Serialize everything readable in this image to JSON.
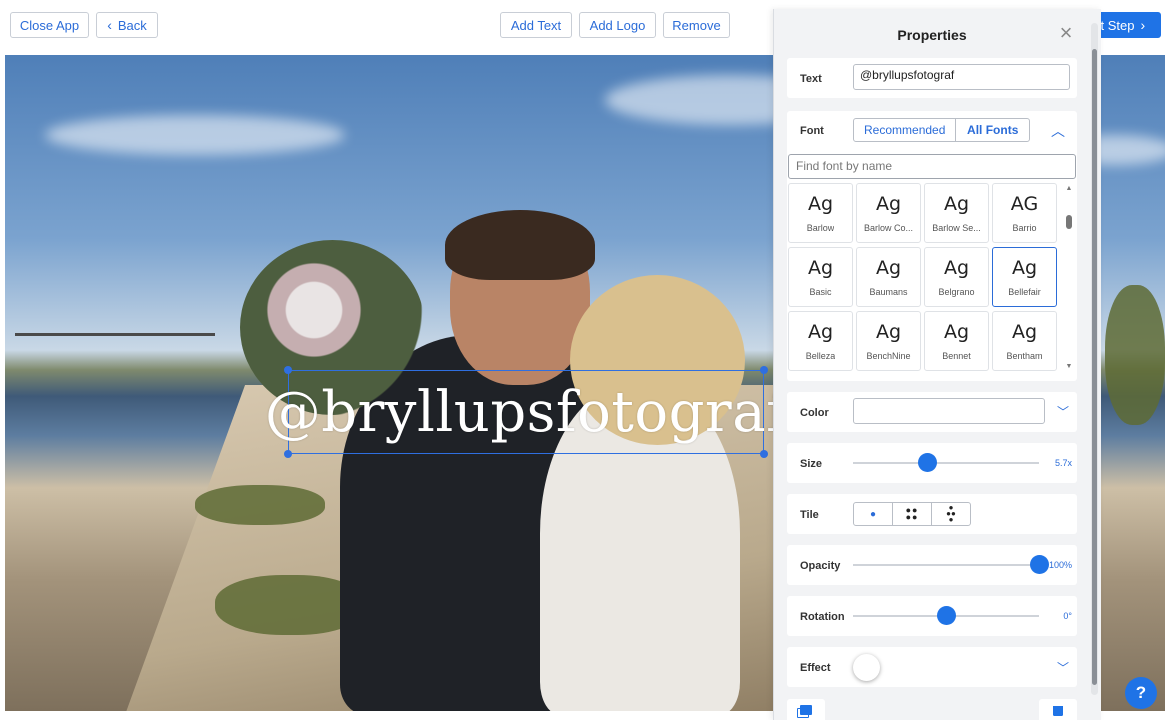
{
  "toolbar": {
    "close_app": "Close App",
    "back": "Back",
    "add_text": "Add Text",
    "add_logo": "Add Logo",
    "remove": "Remove",
    "next_step": "xt Step"
  },
  "canvas": {
    "overlay_text": "@bryllupsfotograf"
  },
  "panel": {
    "title": "Properties",
    "text_label": "Text",
    "text_value": "@bryllupsfotograf",
    "font_label": "Font",
    "font_tabs": [
      "Recommended",
      "All Fonts"
    ],
    "font_search_placeholder": "Find font by name",
    "fonts": [
      {
        "name": "Barlow",
        "sample": "Ag"
      },
      {
        "name": "Barlow Co...",
        "sample": "Ag"
      },
      {
        "name": "Barlow Se...",
        "sample": "Ag"
      },
      {
        "name": "Barrio",
        "sample": "AG"
      },
      {
        "name": "Basic",
        "sample": "Ag"
      },
      {
        "name": "Baumans",
        "sample": "Ag"
      },
      {
        "name": "Belgrano",
        "sample": "Ag"
      },
      {
        "name": "Bellefair",
        "sample": "Ag",
        "selected": true
      },
      {
        "name": "Belleza",
        "sample": "Ag"
      },
      {
        "name": "BenchNine",
        "sample": "Ag"
      },
      {
        "name": "Bennet",
        "sample": "Ag"
      },
      {
        "name": "Bentham",
        "sample": "Ag"
      }
    ],
    "color_label": "Color",
    "size_label": "Size",
    "size_value": "5.7x",
    "size_level": 0.4,
    "tile_label": "Tile",
    "opacity_label": "Opacity",
    "opacity_value": "100%",
    "opacity_level": 1.0,
    "rotation_label": "Rotation",
    "rotation_value": "0°",
    "rotation_level": 0.5,
    "effect_label": "Effect"
  },
  "help": "?",
  "colors": {
    "accent": "#1f73e6",
    "panel_bg": "#f2f3f5"
  }
}
